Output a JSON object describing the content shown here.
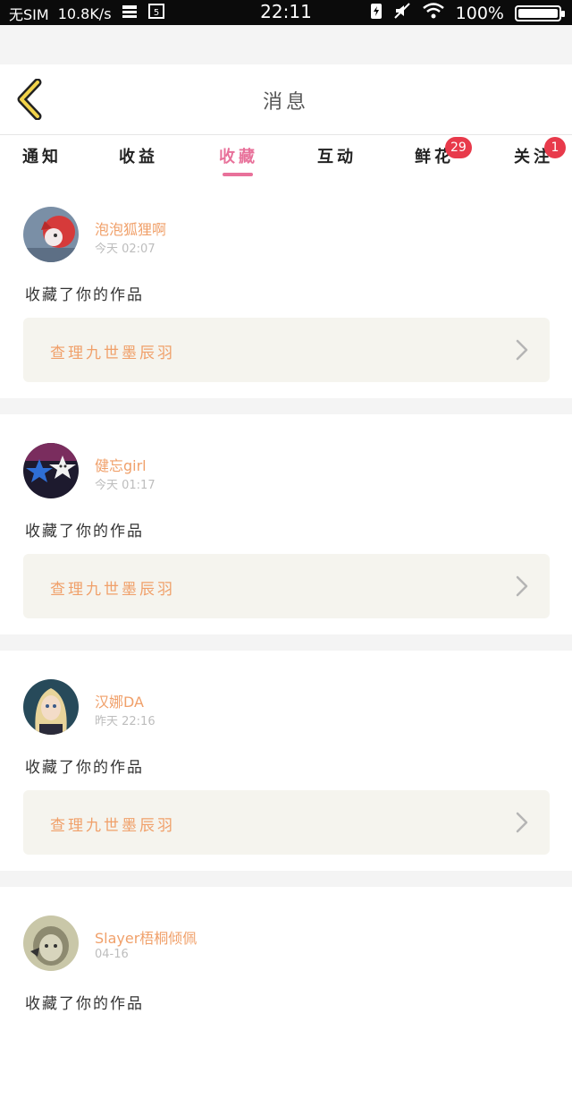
{
  "status_bar": {
    "carrier": "无SIM",
    "speed": "10.8K/s",
    "time": "22:11",
    "battery": "100%",
    "battery_level": 1.0
  },
  "header": {
    "title": "消息"
  },
  "tabs": [
    {
      "label": "通知",
      "active": false,
      "badge": ""
    },
    {
      "label": "收益",
      "active": false,
      "badge": ""
    },
    {
      "label": "收藏",
      "active": true,
      "badge": ""
    },
    {
      "label": "互动",
      "active": false,
      "badge": ""
    },
    {
      "label": "鲜花",
      "active": false,
      "badge": "29"
    },
    {
      "label": "关注",
      "active": false,
      "badge": "1"
    }
  ],
  "feed": [
    {
      "username": "泡泡狐狸啊",
      "time": "今天 02:07",
      "action": "收藏了你的作品",
      "work": "查理九世墨辰羽",
      "avatar": "avatar-red-fox"
    },
    {
      "username": "健忘girl",
      "time": "今天 01:17",
      "action": "收藏了你的作品",
      "work": "查理九世墨辰羽",
      "avatar": "avatar-stars"
    },
    {
      "username": "汉娜DA",
      "time": "昨天 22:16",
      "action": "收藏了你的作品",
      "work": "查理九世墨辰羽",
      "avatar": "avatar-doll"
    },
    {
      "username": "Slayer梧桐倾佩",
      "time": "04-16",
      "action": "收藏了你的作品",
      "work": "",
      "avatar": "avatar-sketch"
    }
  ],
  "colors": {
    "accent_pink": "#e8719a",
    "username_orange": "#f0a06a",
    "badge_red": "#e83a4b",
    "back_yellow": "#f2d34a"
  }
}
